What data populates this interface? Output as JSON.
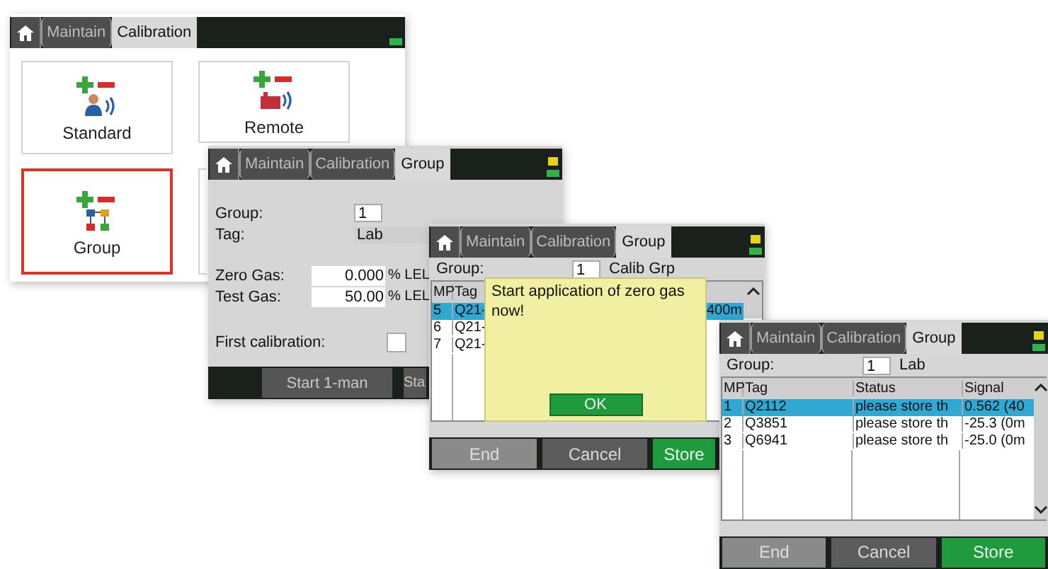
{
  "screens": [
    {
      "kind": "menu",
      "tabs": [
        {
          "label": "Maintain",
          "selected": false
        },
        {
          "label": "Calibration",
          "selected": true
        }
      ],
      "tiles": [
        {
          "kind": "person",
          "label": "Standard",
          "selected": false
        },
        {
          "kind": "device",
          "label": "Remote",
          "selected": false
        },
        {
          "kind": "group",
          "label": "Group",
          "selected": true
        },
        {
          "kind": "blank",
          "selected": false
        }
      ]
    },
    {
      "kind": "setup",
      "tabs": [
        {
          "label": "Maintain",
          "selected": false
        },
        {
          "label": "Calibration",
          "selected": false
        },
        {
          "label": "Group",
          "selected": true
        }
      ],
      "group": {
        "label": "Group:",
        "value": "1"
      },
      "tag": {
        "label": "Tag:",
        "value": "Lab"
      },
      "gases": [
        {
          "label": "Zero Gas:",
          "value": "0.000",
          "unit": "% LEL"
        },
        {
          "label": "Test Gas:",
          "value": "50.00",
          "unit": "% LEL"
        }
      ],
      "first_calibration": {
        "label": "First calibration:",
        "checked": false
      },
      "buttons": [
        "Start 1-man",
        "Sta"
      ]
    },
    {
      "kind": "dialog",
      "tabs": [
        {
          "label": "Maintain",
          "selected": false
        },
        {
          "label": "Calibration",
          "selected": false
        },
        {
          "label": "Group",
          "selected": true
        }
      ],
      "group": {
        "label": "Group:",
        "value": "1",
        "name": "Calib Grp"
      },
      "columns": [
        "MP",
        "Tag"
      ],
      "rows": [
        {
          "cells": [
            "5",
            "Q21-",
            "400m"
          ],
          "selected": true
        },
        {
          "cells": [
            "6",
            "Q21-"
          ],
          "selected": false
        },
        {
          "cells": [
            "7",
            "Q21-"
          ],
          "selected": false
        }
      ],
      "dialog": {
        "message": "Start application of zero gas now!",
        "button": "OK"
      },
      "buttons": [
        {
          "label": "End",
          "kind": "disabled"
        },
        {
          "label": "Cancel",
          "kind": "plain"
        },
        {
          "label": "Store",
          "kind": "confirm"
        }
      ]
    },
    {
      "kind": "table",
      "tabs": [
        {
          "label": "Maintain",
          "selected": false
        },
        {
          "label": "Calibration",
          "selected": false
        },
        {
          "label": "Group",
          "selected": true
        }
      ],
      "group": {
        "label": "Group:",
        "value": "1",
        "name": "Lab"
      },
      "columns": [
        "MP",
        "Tag",
        "Status",
        "Signal"
      ],
      "rows": [
        {
          "cells": [
            "1",
            "Q2112",
            "please store th",
            "0.562 (40"
          ],
          "selected": true
        },
        {
          "cells": [
            "2",
            "Q3851",
            "please store th",
            "-25.3 (0m"
          ],
          "selected": false
        },
        {
          "cells": [
            "3",
            "Q6941",
            "please store th",
            "-25.0 (0m"
          ],
          "selected": false
        }
      ],
      "buttons": [
        {
          "label": "End",
          "kind": "disabled"
        },
        {
          "label": "Cancel",
          "kind": "plain"
        },
        {
          "label": "Store",
          "kind": "confirm"
        }
      ]
    }
  ]
}
